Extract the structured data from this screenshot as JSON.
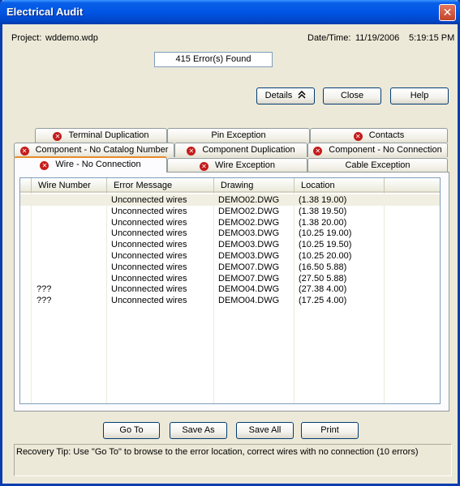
{
  "window": {
    "title": "Electrical Audit",
    "close_glyph": "✕"
  },
  "header": {
    "project_label": "Project:",
    "project_value": "wddemo.wdp",
    "datetime_label": "Date/Time:",
    "date_value": "11/19/2006",
    "time_value": "5:19:15 PM",
    "errors_found": "415 Error(s) Found"
  },
  "top_buttons": {
    "details": "Details",
    "details_icon": "double-chevron-up-icon",
    "close": "Close",
    "help": "Help"
  },
  "tabs": {
    "row1": [
      {
        "label": "Terminal Duplication",
        "has_error": true
      },
      {
        "label": "Pin Exception",
        "has_error": false
      },
      {
        "label": "Contacts",
        "has_error": true
      }
    ],
    "row2": [
      {
        "label": "Component - No Catalog Number",
        "has_error": true
      },
      {
        "label": "Component Duplication",
        "has_error": true
      },
      {
        "label": "Component - No Connection",
        "has_error": true
      }
    ],
    "row3": [
      {
        "label": "Wire - No Connection",
        "has_error": true,
        "active": true
      },
      {
        "label": "Wire Exception",
        "has_error": true
      },
      {
        "label": "Cable Exception",
        "has_error": false
      }
    ]
  },
  "table": {
    "columns": [
      "Wire Number",
      "Error Message",
      "Drawing",
      "Location"
    ],
    "rows": [
      [
        "",
        "Unconnected wires",
        "DEMO02.DWG",
        "(1.38 19.00)"
      ],
      [
        "",
        "Unconnected wires",
        "DEMO02.DWG",
        "(1.38 19.50)"
      ],
      [
        "",
        "Unconnected wires",
        "DEMO02.DWG",
        "(1.38 20.00)"
      ],
      [
        "",
        "Unconnected wires",
        "DEMO03.DWG",
        "(10.25 19.00)"
      ],
      [
        "",
        "Unconnected wires",
        "DEMO03.DWG",
        "(10.25 19.50)"
      ],
      [
        "",
        "Unconnected wires",
        "DEMO03.DWG",
        "(10.25 20.00)"
      ],
      [
        "",
        "Unconnected wires",
        "DEMO07.DWG",
        "(16.50 5.88)"
      ],
      [
        "",
        "Unconnected wires",
        "DEMO07.DWG",
        "(27.50 5.88)"
      ],
      [
        "???",
        "Unconnected wires",
        "DEMO04.DWG",
        "(27.38 4.00)"
      ],
      [
        "???",
        "Unconnected wires",
        "DEMO04.DWG",
        "(17.25 4.00)"
      ]
    ]
  },
  "bottom_buttons": {
    "goto": "Go To",
    "save_as": "Save As",
    "save_all": "Save All",
    "print": "Print"
  },
  "recovery_tip": "Recovery Tip: Use \"Go To\" to browse to the error location, correct wires with no connection (10 errors)",
  "colors": {
    "title_bar": "#0055e5",
    "active_tab_accent": "#e68b2c",
    "error_icon": "#c51b1b"
  }
}
